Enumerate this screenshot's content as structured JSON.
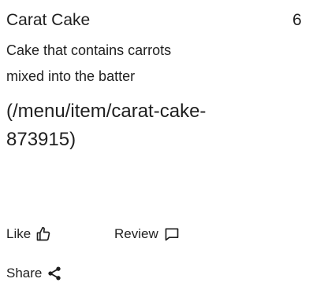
{
  "item": {
    "name": "Carat Cake",
    "price": "6",
    "description": "Cake that contains carrots mixed into the batter",
    "link_text": "(/menu/item/carat-cake-873915)"
  },
  "actions": {
    "like_label": "Like",
    "like_icon": "thumbs-up-icon",
    "review_label": "Review",
    "review_icon": "comment-icon",
    "share_label": "Share",
    "share_icon": "share-icon"
  }
}
